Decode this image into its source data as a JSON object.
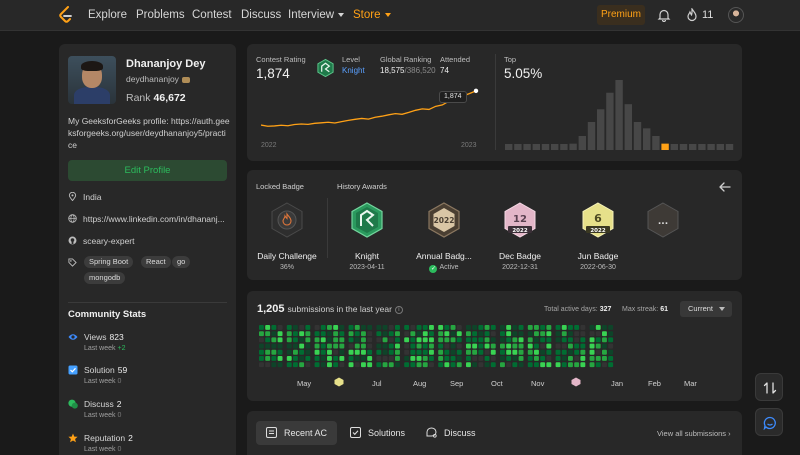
{
  "nav": {
    "items": [
      "Explore",
      "Problems",
      "Contest",
      "Discuss",
      "Interview",
      "Store"
    ],
    "premium": "Premium",
    "streak": "11"
  },
  "profile": {
    "name": "Dhananjoy Dey",
    "username": "deydhananjoy",
    "rank_label": "Rank",
    "rank": "46,672",
    "bio": "My GeeksforGeeks profile: https://auth.geeksforgeeks.org/user/deydhananjoy5/practice",
    "edit_label": "Edit Profile",
    "location": "India",
    "linkedin": "https://www.linkedin.com/in/dhananj...",
    "github": "sceary-expert",
    "tags": [
      "Spring Boot",
      "React",
      "go",
      "mongodb"
    ]
  },
  "community": {
    "title": "Community Stats",
    "stats": [
      {
        "label": "Views",
        "value": "823",
        "sub": "Last week",
        "delta": "+2",
        "icon": "eye-icon",
        "color": "#3d8bfd"
      },
      {
        "label": "Solution",
        "value": "59",
        "sub": "Last week",
        "delta": "0",
        "icon": "solution-icon",
        "color": "#45a0ff"
      },
      {
        "label": "Discuss",
        "value": "2",
        "sub": "Last week",
        "delta": "0",
        "icon": "discuss-icon",
        "color": "#2cbb5d"
      },
      {
        "label": "Reputation",
        "value": "2",
        "sub": "Last week",
        "delta": "0",
        "icon": "star-icon",
        "color": "#ffa116"
      }
    ]
  },
  "contest": {
    "rating_label": "Contest Rating",
    "rating": "1,874",
    "level_label": "Level",
    "level": "Knight",
    "global_label": "Global Ranking",
    "global_rank": "18,575",
    "global_total": "/386,520",
    "attended_label": "Attended",
    "attended": "74",
    "top_label": "Top",
    "top": "5.05%",
    "point_label": "1,874",
    "year_start": "2022",
    "year_end": "2023",
    "line_color": "#ffa116"
  },
  "chart_data": [
    {
      "type": "line",
      "series": [
        {
          "values": [
            1480,
            1466,
            1470,
            1478,
            1472,
            1486,
            1492,
            1488,
            1500,
            1506,
            1512,
            1504,
            1520,
            1534,
            1546,
            1556,
            1548,
            1570,
            1582,
            1598,
            1612,
            1604,
            1626,
            1650,
            1666,
            1660,
            1696,
            1712,
            1756,
            1790,
            1812,
            1842,
            1874
          ]
        }
      ],
      "xlabel": "",
      "ylabel": ""
    },
    {
      "type": "bar",
      "values": [
        1,
        1,
        1,
        1,
        1,
        2,
        3,
        5,
        11,
        22,
        32,
        45,
        55,
        36,
        22,
        17,
        11,
        5,
        3,
        2,
        1,
        1,
        1,
        1,
        1
      ],
      "highlight_index": 17,
      "xlabel": "",
      "ylabel": ""
    }
  ],
  "badges": {
    "locked_label": "Locked Badge",
    "history_label": "History Awards",
    "items": [
      {
        "name": "Daily Challenge",
        "sub": "36%",
        "kind": "locked"
      },
      {
        "name": "Knight",
        "sub": "2023-04-11",
        "kind": "knight"
      },
      {
        "name": "Annual Badg...",
        "sub": "Active",
        "kind": "annual",
        "year": "2022"
      },
      {
        "name": "Dec Badge",
        "sub": "2022-12-31",
        "kind": "month",
        "num": "12",
        "year": "2022",
        "color": "#e3b6c8"
      },
      {
        "name": "Jun Badge",
        "sub": "2022-06-30",
        "kind": "month",
        "num": "6",
        "year": "2022",
        "color": "#e6e08a"
      }
    ],
    "more": "..."
  },
  "activity": {
    "count": "1,205",
    "label": "submissions in the last year",
    "active_label": "Total active days:",
    "active_days": "327",
    "streak_label": "Max streak:",
    "max_streak": "61",
    "dropdown": "Current",
    "months": [
      "May",
      "Jul",
      "Aug",
      "Sep",
      "Oct",
      "Nov",
      "Jan",
      "Feb",
      "Mar"
    ]
  },
  "tabs": {
    "items": [
      "Recent AC",
      "Solutions",
      "Discuss"
    ],
    "view_all": "View all submissions"
  }
}
